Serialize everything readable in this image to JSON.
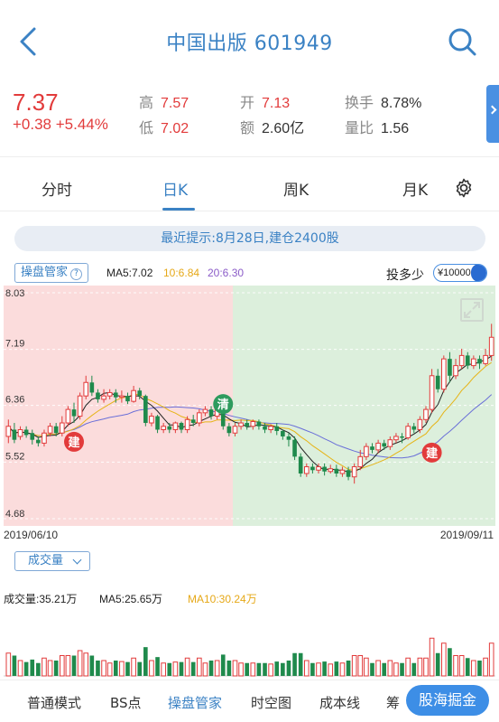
{
  "header": {
    "title": "中国出版 601949",
    "back_icon": "chevron-left-icon",
    "search_icon": "search-icon"
  },
  "quote": {
    "price": "7.37",
    "change": "+0.38 +5.44%",
    "high_label": "高",
    "high": "7.57",
    "low_label": "低",
    "low": "7.02",
    "open_label": "开",
    "open": "7.13",
    "amount_label": "额",
    "amount": "2.60亿",
    "turnover_label": "换手",
    "turnover": "8.78%",
    "volume_ratio_label": "量比",
    "volume_ratio": "1.56"
  },
  "tabs": [
    "分时",
    "日K",
    "周K",
    "月K"
  ],
  "active_tab": "日K",
  "hint": "最近提示:8月28日,建仓2400股",
  "indicator": {
    "button": "操盘管家",
    "ma5": "MA5:7.02",
    "ma10": "10:6.84",
    "ma20": "20:6.30",
    "tdsl": "投多少",
    "amount": "¥100000"
  },
  "chart_data": {
    "type": "candlestick",
    "y_ticks": [
      "8.03",
      "7.19",
      "6.36",
      "5.52",
      "4.68"
    ],
    "ylim": [
      4.68,
      8.03
    ],
    "x_start": "2019/06/10",
    "x_end": "2019/09/11",
    "markers": [
      {
        "label": "建",
        "index": 11,
        "price": 5.82,
        "color": "#e23b3b"
      },
      {
        "label": "清",
        "index": 36,
        "price": 6.38,
        "color": "#2e9b5e"
      },
      {
        "label": "建",
        "index": 71,
        "price": 5.66,
        "color": "#e23b3b"
      }
    ],
    "candles": [
      [
        5.9,
        6.05,
        5.8,
        6.15
      ],
      [
        6.0,
        5.85,
        5.8,
        6.1
      ],
      [
        5.9,
        6.0,
        5.85,
        6.05
      ],
      [
        6.0,
        5.92,
        5.88,
        6.05
      ],
      [
        5.95,
        5.85,
        5.78,
        6.0
      ],
      [
        5.85,
        5.8,
        5.75,
        5.9
      ],
      [
        5.8,
        5.95,
        5.75,
        6.0
      ],
      [
        5.95,
        6.05,
        5.9,
        6.1
      ],
      [
        6.05,
        5.95,
        5.9,
        6.1
      ],
      [
        5.95,
        6.1,
        5.9,
        6.2
      ],
      [
        6.1,
        6.3,
        6.05,
        6.35
      ],
      [
        6.3,
        6.2,
        6.1,
        6.4
      ],
      [
        6.2,
        6.5,
        6.15,
        6.55
      ],
      [
        6.5,
        6.7,
        6.45,
        6.8
      ],
      [
        6.7,
        6.55,
        6.5,
        6.8
      ],
      [
        6.55,
        6.45,
        6.4,
        6.6
      ],
      [
        6.45,
        6.5,
        6.4,
        6.6
      ],
      [
        6.5,
        6.55,
        6.45,
        6.6
      ],
      [
        6.55,
        6.48,
        6.4,
        6.6
      ],
      [
        6.48,
        6.5,
        6.4,
        6.58
      ],
      [
        6.5,
        6.42,
        6.38,
        6.55
      ],
      [
        6.42,
        6.58,
        6.4,
        6.65
      ],
      [
        6.58,
        6.5,
        6.45,
        6.62
      ],
      [
        6.5,
        6.1,
        6.05,
        6.52
      ],
      [
        6.1,
        6.2,
        6.05,
        6.25
      ],
      [
        6.2,
        6.0,
        5.95,
        6.22
      ],
      [
        6.0,
        6.05,
        5.95,
        6.1
      ],
      [
        6.05,
        6.0,
        5.95,
        6.1
      ],
      [
        6.0,
        6.1,
        5.95,
        6.12
      ],
      [
        6.1,
        6.0,
        5.95,
        6.12
      ],
      [
        6.0,
        6.15,
        5.95,
        6.2
      ],
      [
        6.15,
        6.1,
        6.05,
        6.22
      ],
      [
        6.1,
        6.25,
        6.05,
        6.3
      ],
      [
        6.25,
        6.3,
        6.2,
        6.35
      ],
      [
        6.3,
        6.2,
        6.15,
        6.35
      ],
      [
        6.2,
        6.3,
        6.15,
        6.35
      ],
      [
        6.3,
        6.05,
        6.0,
        6.32
      ],
      [
        6.05,
        5.95,
        5.9,
        6.1
      ],
      [
        5.95,
        6.05,
        5.9,
        6.1
      ],
      [
        6.05,
        6.1,
        6.0,
        6.15
      ],
      [
        6.1,
        6.05,
        6.0,
        6.15
      ],
      [
        6.05,
        6.12,
        6.0,
        6.15
      ],
      [
        6.12,
        6.05,
        6.0,
        6.15
      ],
      [
        6.05,
        6.0,
        5.95,
        6.1
      ],
      [
        6.0,
        6.05,
        5.95,
        6.08
      ],
      [
        6.05,
        5.98,
        5.92,
        6.1
      ],
      [
        5.98,
        5.9,
        5.85,
        6.0
      ],
      [
        5.9,
        5.85,
        5.75,
        5.95
      ],
      [
        5.85,
        5.6,
        5.55,
        5.9
      ],
      [
        5.6,
        5.35,
        5.3,
        5.65
      ],
      [
        5.35,
        5.45,
        5.3,
        5.5
      ],
      [
        5.45,
        5.4,
        5.35,
        5.5
      ],
      [
        5.4,
        5.45,
        5.35,
        5.5
      ],
      [
        5.45,
        5.38,
        5.32,
        5.5
      ],
      [
        5.38,
        5.42,
        5.35,
        5.48
      ],
      [
        5.42,
        5.35,
        5.3,
        5.48
      ],
      [
        5.35,
        5.4,
        5.3,
        5.45
      ],
      [
        5.4,
        5.3,
        5.25,
        5.45
      ],
      [
        5.3,
        5.45,
        5.2,
        5.5
      ],
      [
        5.45,
        5.6,
        5.4,
        5.7
      ],
      [
        5.6,
        5.75,
        5.55,
        5.8
      ],
      [
        5.75,
        5.7,
        5.65,
        5.8
      ],
      [
        5.7,
        5.8,
        5.65,
        5.85
      ],
      [
        5.8,
        5.75,
        5.7,
        5.85
      ],
      [
        5.75,
        5.85,
        5.7,
        5.9
      ],
      [
        5.85,
        5.9,
        5.8,
        5.95
      ],
      [
        5.9,
        5.88,
        5.8,
        5.95
      ],
      [
        5.88,
        6.05,
        5.85,
        6.1
      ],
      [
        6.05,
        6.0,
        5.95,
        6.1
      ],
      [
        6.0,
        6.15,
        5.95,
        6.2
      ],
      [
        6.15,
        6.3,
        6.1,
        6.35
      ],
      [
        6.3,
        6.8,
        6.25,
        6.9
      ],
      [
        6.8,
        6.6,
        6.55,
        6.9
      ],
      [
        6.6,
        7.05,
        6.55,
        7.1
      ],
      [
        7.05,
        6.8,
        6.7,
        7.15
      ],
      [
        6.8,
        6.95,
        6.75,
        7.05
      ],
      [
        6.95,
        7.1,
        6.9,
        7.2
      ],
      [
        7.1,
        6.95,
        6.9,
        7.15
      ],
      [
        6.95,
        7.05,
        6.9,
        7.1
      ],
      [
        7.05,
        6.98,
        6.9,
        7.1
      ],
      [
        6.98,
        7.1,
        6.95,
        7.2
      ],
      [
        7.1,
        7.37,
        7.02,
        7.57
      ]
    ]
  },
  "volume": {
    "button": "成交量",
    "label": "成交量:35.21万",
    "ma5": "MA5:25.65万",
    "ma10": "MA10:30.24万"
  },
  "bottom_nav": {
    "items": [
      "普通模式",
      "BS点",
      "操盘管家",
      "时空图",
      "成本线",
      "筹"
    ],
    "active": "操盘管家",
    "gold_button": "股海掘金"
  },
  "colors": {
    "accent": "#3b82c4",
    "up": "#e23b3b",
    "down": "#1f8a4c",
    "buy_zone": "#fbdcdc",
    "sell_zone": "#dcefdc"
  }
}
